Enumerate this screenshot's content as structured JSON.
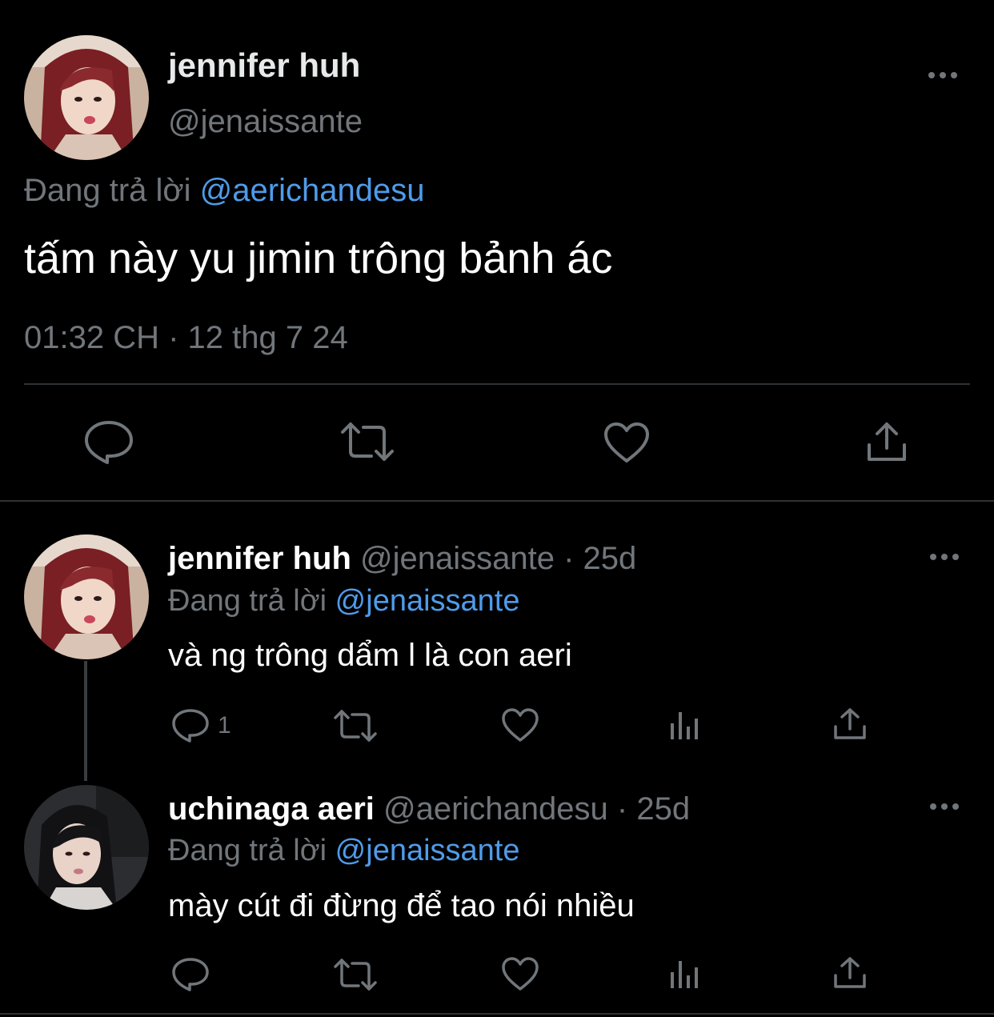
{
  "colors": {
    "background": "#000000",
    "text_primary": "#ffffff",
    "text_secondary": "#71767b",
    "mention": "#4f9be9",
    "divider": "#2f3336"
  },
  "main_tweet": {
    "author_name": "jennifer huh",
    "handle": "@jenaissante",
    "replying_label": "Đang trả lời",
    "replying_to": "@aerichandesu",
    "text": "tấm này yu jimin trông bảnh ác",
    "meta": "01:32 CH · 12 thg 7 24",
    "avatar_icon": "avatar-red-hair-photo",
    "more_icon": "more-horizontal-icon",
    "actions": [
      "reply-icon",
      "retweet-icon",
      "like-icon",
      "share-icon"
    ]
  },
  "replies": [
    {
      "author_name": "jennifer huh",
      "handle": "@jenaissante",
      "time": "· 25d",
      "replying_label": "Đang trả lời",
      "replying_to": "@jenaissante",
      "text": "và ng trông dẩm l là con aeri",
      "reply_count": "1",
      "avatar_icon": "avatar-red-hair-photo"
    },
    {
      "author_name": "uchinaga aeri",
      "handle": "@aerichandesu",
      "time": "· 25d",
      "replying_label": "Đang trả lời",
      "replying_to": "@jenaissante",
      "text": "mày cút đi đừng để tao nói nhiều",
      "reply_count": "",
      "avatar_icon": "avatar-dark-hair-photo"
    }
  ]
}
